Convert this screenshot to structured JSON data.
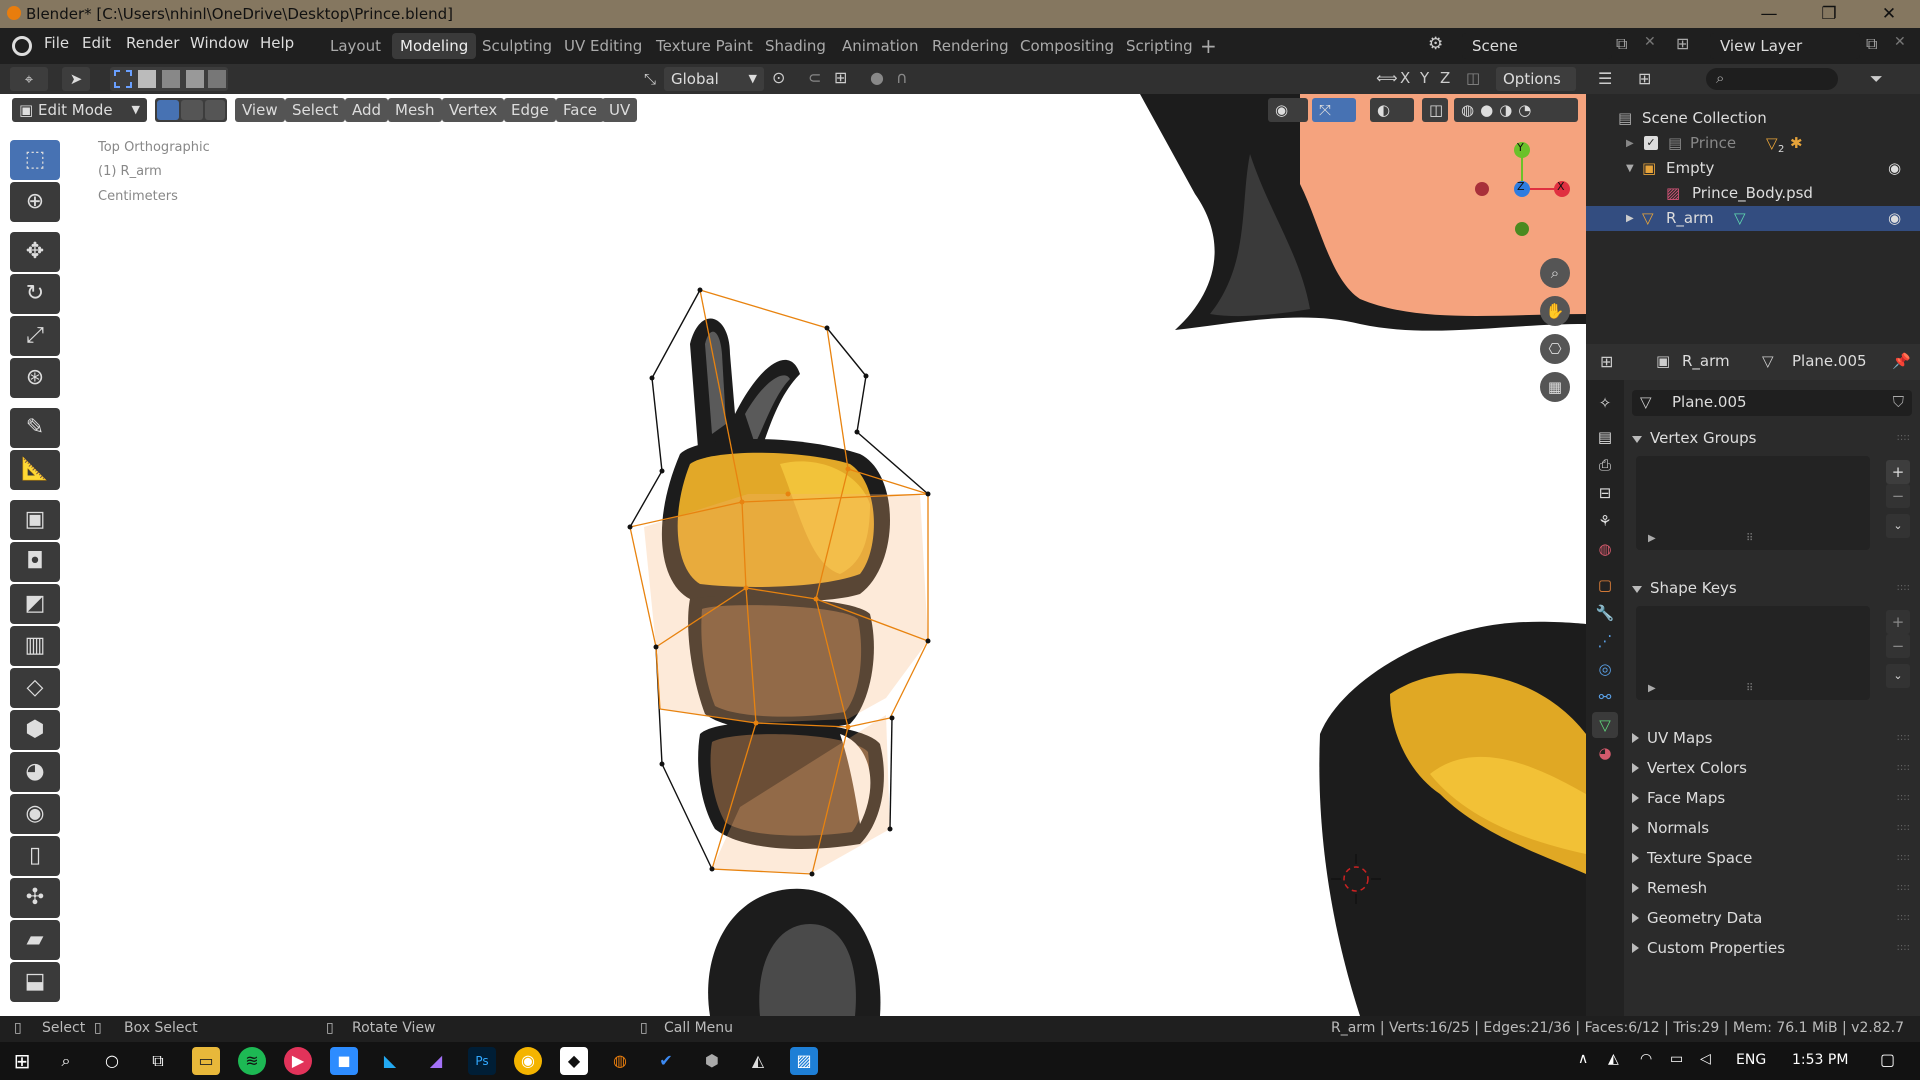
{
  "window": {
    "title": "Blender* [C:\\Users\\nhinl\\OneDrive\\Desktop\\Prince.blend]",
    "minimize": "—",
    "maximize": "❐",
    "close": "✕"
  },
  "menus": [
    "File",
    "Edit",
    "Render",
    "Window",
    "Help"
  ],
  "workspaces": [
    "Layout",
    "Modeling",
    "Sculpting",
    "UV Editing",
    "Texture Paint",
    "Shading",
    "Animation",
    "Rendering",
    "Compositing",
    "Scripting"
  ],
  "active_workspace": "Modeling",
  "scene": {
    "name": "Scene",
    "view_layer": "View Layer"
  },
  "header": {
    "transform_orientation": "Global",
    "options_label": "Options",
    "axes": [
      "X",
      "Y",
      "Z"
    ]
  },
  "viewport_header": {
    "mode": "Edit Mode",
    "menus": [
      "View",
      "Select",
      "Add",
      "Mesh",
      "Vertex",
      "Edge",
      "Face",
      "UV"
    ]
  },
  "viewport_info": {
    "view": "Top Orthographic",
    "object": "(1) R_arm",
    "units": "Centimeters"
  },
  "gizmo": {
    "y": "Y",
    "z": "Z",
    "x": "X"
  },
  "outliner": {
    "root": "Scene Collection",
    "items": [
      {
        "name": "Prince",
        "badge": "2"
      },
      {
        "name": "Empty"
      },
      {
        "name": "Prince_Body.psd"
      },
      {
        "name": "R_arm"
      }
    ]
  },
  "properties": {
    "object_name": "R_arm",
    "mesh_name": "Plane.005",
    "data_block": "Plane.005",
    "panels": [
      {
        "label": "Vertex Groups",
        "expanded": true
      },
      {
        "label": "Shape Keys",
        "expanded": true
      },
      {
        "label": "UV Maps",
        "expanded": false
      },
      {
        "label": "Vertex Colors",
        "expanded": false
      },
      {
        "label": "Face Maps",
        "expanded": false
      },
      {
        "label": "Normals",
        "expanded": false
      },
      {
        "label": "Texture Space",
        "expanded": false
      },
      {
        "label": "Remesh",
        "expanded": false
      },
      {
        "label": "Geometry Data",
        "expanded": false
      },
      {
        "label": "Custom Properties",
        "expanded": false
      }
    ]
  },
  "statusbar": {
    "select": "Select",
    "box_select": "Box Select",
    "rotate_view": "Rotate View",
    "call_menu": "Call Menu",
    "stats": "R_arm | Verts:16/25 | Edges:21/36 | Faces:6/12 | Tris:29 | Mem: 76.1 MiB | v2.82.7"
  },
  "taskbar": {
    "language": "ENG",
    "time": "1:53 PM"
  },
  "colors": {
    "selection": "#e8830f",
    "active_tab": "#4772b3",
    "outliner_selected": "#334d80"
  }
}
